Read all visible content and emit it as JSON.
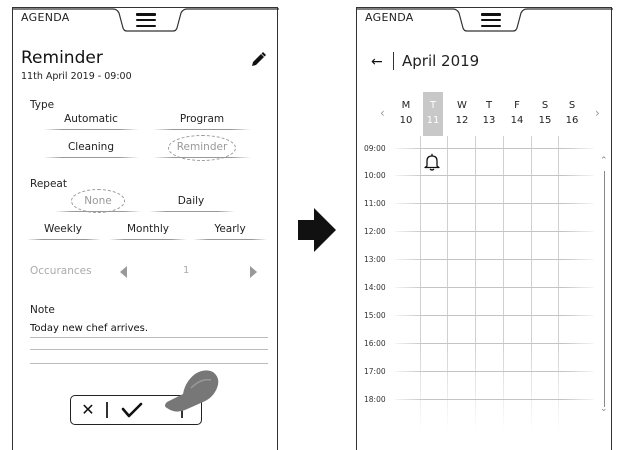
{
  "left": {
    "app_label": "AGENDA",
    "title": "Reminder",
    "datetime": "11th April 2019 - 09:00",
    "type_label": "Type",
    "type_options": [
      "Automatic",
      "Program",
      "Cleaning",
      "Reminder"
    ],
    "type_selected": "Reminder",
    "repeat_label": "Repeat",
    "repeat_options": [
      "None",
      "Daily",
      "Weekly",
      "Monthly",
      "Yearly"
    ],
    "repeat_selected": "None",
    "occurances_label": "Occurances",
    "occurances_value": "1",
    "note_label": "Note",
    "note_text": "Today new chef arrives.",
    "cancel_symbol": "✕"
  },
  "right": {
    "app_label": "AGENDA",
    "back_symbol": "←",
    "month_title": "April 2019",
    "nav_prev": "‹",
    "nav_next": "›",
    "days": [
      {
        "letter": "M",
        "number": "10",
        "today": false
      },
      {
        "letter": "T",
        "number": "11",
        "today": true
      },
      {
        "letter": "W",
        "number": "12",
        "today": false
      },
      {
        "letter": "T",
        "number": "13",
        "today": false
      },
      {
        "letter": "F",
        "number": "14",
        "today": false
      },
      {
        "letter": "S",
        "number": "15",
        "today": false
      },
      {
        "letter": "S",
        "number": "16",
        "today": false
      }
    ],
    "times": [
      "09:00",
      "10:00",
      "11:00",
      "12:00",
      "13:00",
      "14:00",
      "15:00",
      "16:00",
      "17:00",
      "18:00"
    ],
    "scroll_up": "⌃",
    "scroll_down": "⌄"
  },
  "colors": {
    "today_highlight": "#c8c8c8",
    "selected_option": "#999999",
    "disabled_text": "#aaaaaa",
    "arrow": "#111111"
  },
  "icons": [
    "hamburger-icon",
    "pencil-icon",
    "chevron-left-icon",
    "chevron-right-icon",
    "close-icon",
    "check-icon",
    "hand-pointer-icon",
    "arrow-left-icon",
    "bell-icon"
  ]
}
